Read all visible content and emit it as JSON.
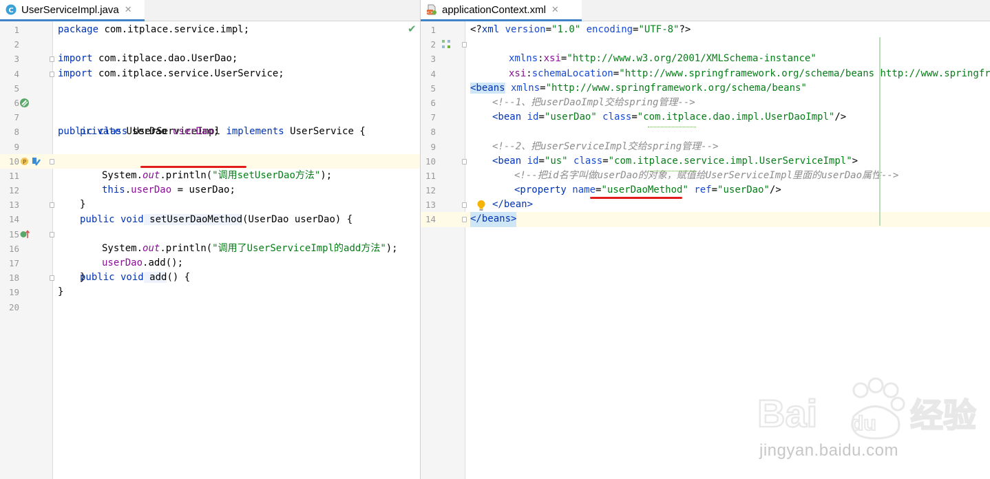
{
  "left_editor": {
    "tab": {
      "label": "UserServiceImpl.java",
      "icon": "java-class-icon"
    },
    "line_numbers": [
      "1",
      "2",
      "3",
      "4",
      "5",
      "6",
      "7",
      "8",
      "9",
      "10",
      "11",
      "12",
      "13",
      "14",
      "15",
      "16",
      "17",
      "18",
      "19",
      "20"
    ],
    "code": {
      "l1_kw": "package",
      "l1_rest": " com.itplace.service.impl;",
      "l3_kw": "import",
      "l3_rest": " com.itplace.dao.UserDao;",
      "l4_kw": "import",
      "l4_rest": " com.itplace.service.UserService;",
      "l6_kw1": "public class",
      "l6_name": " UserServiceImpl ",
      "l6_kw2": "implements",
      "l6_rest": " UserService {",
      "l8_kw": "private",
      "l8_type": " UserDao ",
      "l8_field": "userDao",
      "l8_end": ";",
      "l10_kw": "public void",
      "l10_method": " setUserDaoMethod",
      "l10_rest": "(UserDao userDao) {",
      "l11_pre": "System.",
      "l11_out": "out",
      "l11_mid": ".println(",
      "l11_str": "\"调用setUserDao方法\"",
      "l11_end": ");",
      "l12_kw": "this",
      "l12_dot": ".",
      "l12_field": "userDao",
      "l12_rest": " = userDao;",
      "l13": "}",
      "l15_kw": "public void",
      "l15_method": " add",
      "l15_rest": "() {",
      "l16_pre": "System.",
      "l16_out": "out",
      "l16_mid": ".println(",
      "l16_str": "\"调用了UserServiceImpl的add方法\"",
      "l16_end": ");",
      "l17_field": "userDao",
      "l17_rest": ".add();",
      "l18": "}",
      "l19": "}"
    },
    "gutter_icons": [
      "implementing-class-icon",
      "override-method-icon",
      "implemented-method-icon"
    ],
    "status_icon": "inspection-ok-check-icon"
  },
  "right_editor": {
    "tab": {
      "label": "applicationContext.xml",
      "icon": "spring-xml-file-icon"
    },
    "line_numbers": [
      "1",
      "2",
      "3",
      "4",
      "5",
      "6",
      "7",
      "8",
      "9",
      "10",
      "11",
      "12",
      "13",
      "14"
    ],
    "code": {
      "l1_a": "<?",
      "l1_tag": "xml",
      "l1_attr1": " version",
      "l1_eq1": "=",
      "l1_val1": "\"1.0\"",
      "l1_attr2": " encoding",
      "l1_eq2": "=",
      "l1_val2": "\"UTF-8\"",
      "l1_end": "?>",
      "l2_open": "<beans",
      "l2_attr": " xmlns",
      "l2_eq": "=",
      "l2_val": "\"http://www.springframework.org/schema/beans\"",
      "l3_ns": "xmlns",
      "l3_colon": ":",
      "l3_attr": "xsi",
      "l3_eq": "=",
      "l3_val": "\"http://www.w3.org/2001/XMLSchema-instance\"",
      "l4_ns": "xsi",
      "l4_colon": ":",
      "l4_attr": "schemaLocation",
      "l4_eq": "=",
      "l4_val": "\"http://www.springframework.org/schema/beans http://www.springframewo",
      "l6_cmt": "<!--1、把userDaoImpl交给spring管理-->",
      "l7_open": "<bean",
      "l7_attr1": " id",
      "l7_eq1": "=",
      "l7_val1": "\"userDao\"",
      "l7_attr2": " class",
      "l7_eq2": "=",
      "l7_val2": "\"com.itplace.dao.impl.UserDaoImpl\"",
      "l7_end": "/>",
      "l9_cmt": "<!--2、把userServiceImpl交给spring管理-->",
      "l10_open": "<bean",
      "l10_attr1": " id",
      "l10_eq1": "=",
      "l10_val1": "\"us\"",
      "l10_attr2": " class",
      "l10_eq2": "=",
      "l10_val2": "\"com.itplace.service.impl.UserServiceImpl\"",
      "l10_end": ">",
      "l11_cmt": "<!--把id名字叫做userDao的对象，赋值给UserServiceImpl里面的userDao属性-->",
      "l12_open": "<property",
      "l12_attr1": " name",
      "l12_eq1": "=",
      "l12_val1": "\"userDaoMethod\"",
      "l12_attr2": " ref",
      "l12_eq2": "=",
      "l12_val2": "\"userDao\"",
      "l12_end": "/>",
      "l13": "</bean>",
      "l14": "</beans>"
    },
    "gutter_icons": [
      "spring-beans-gutter-icon",
      "intention-bulb-icon"
    ]
  },
  "watermark": {
    "logo": "Bai du 经验",
    "site": "jingyan.baidu.com"
  }
}
